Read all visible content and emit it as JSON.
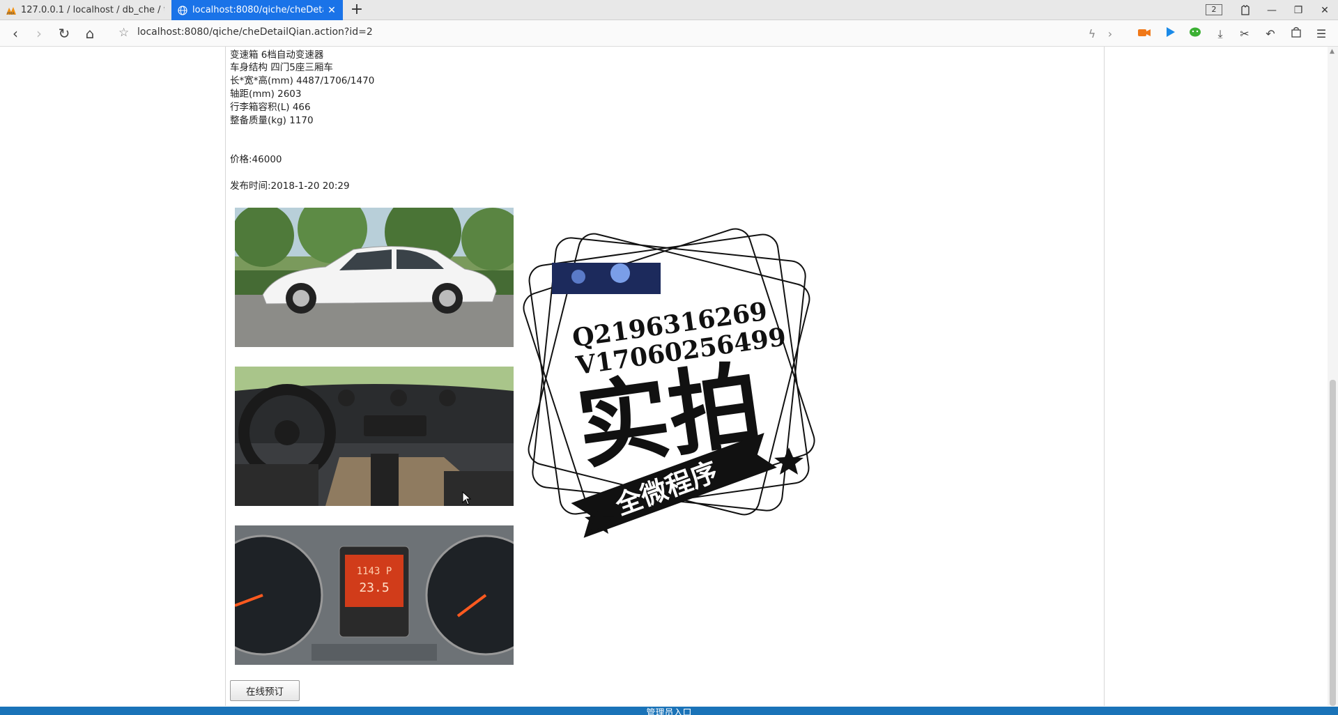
{
  "browser": {
    "tabs": [
      {
        "title": "127.0.0.1 / localhost / db_che / t_p",
        "favicon": "phpmyadmin-icon",
        "active": false
      },
      {
        "title": "localhost:8080/qiche/cheDetailQi",
        "favicon": "globe-icon",
        "active": true
      }
    ],
    "tab_count": "2",
    "url": "localhost:8080/qiche/cheDetailQian.action?id=2"
  },
  "car": {
    "specs": [
      "变速箱 6档自动变速器",
      "车身结构 四门5座三厢车",
      "长*宽*高(mm) 4487/1706/1470",
      "轴距(mm) 2603",
      "行李箱容积(L) 466",
      "整备质量(kg) 1170"
    ],
    "price": "价格:46000",
    "published": "发布时间:2018-1-20 20:29",
    "photos": [
      "car-side-photo",
      "car-interior-photo",
      "car-dashboard-photo"
    ],
    "book_button": "在线预订"
  },
  "watermark": {
    "qq": "Q2196316269",
    "wechat": "V17060256499",
    "headline": "实拍",
    "banner": "全微程序"
  },
  "footer": {
    "admin_link": "管理员入口"
  },
  "colors": {
    "accent": "#1a73e8",
    "footer": "#1a73b8"
  }
}
